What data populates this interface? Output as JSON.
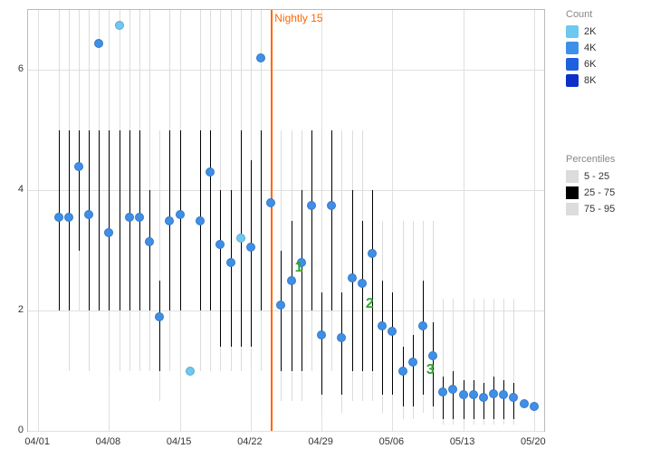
{
  "chart_data": {
    "type": "scatter",
    "title": "",
    "xlabel": "",
    "ylabel": "",
    "ylim": [
      0,
      7
    ],
    "x_ticks": [
      "04/01",
      "04/08",
      "04/15",
      "04/22",
      "04/29",
      "05/06",
      "05/13",
      "05/20"
    ],
    "y_ticks": [
      0,
      2,
      4,
      6
    ],
    "nightly_marker": {
      "label": "Nightly 15",
      "x_index": 24
    },
    "annotations": [
      {
        "label": "1",
        "x_index": 26,
        "y": 2.7
      },
      {
        "label": "2",
        "x_index": 33,
        "y": 2.1
      },
      {
        "label": "3",
        "x_index": 39,
        "y": 1.0
      }
    ],
    "legend_count": {
      "title": "Count",
      "items": [
        {
          "label": "2K",
          "color": "#6ec8f0"
        },
        {
          "label": "4K",
          "color": "#3f8fe8"
        },
        {
          "label": "6K",
          "color": "#1f60e0"
        },
        {
          "label": "8K",
          "color": "#0c30c8"
        }
      ]
    },
    "legend_pct": {
      "title": "Percentiles",
      "items": [
        {
          "label": "5 - 25",
          "color": "#dcdcdc"
        },
        {
          "label": "25 - 75",
          "color": "#000000"
        },
        {
          "label": "75 - 95",
          "color": "#dcdcdc"
        }
      ]
    },
    "points": [
      {
        "x": 3,
        "y": 3.55,
        "c": "#3f8fe8"
      },
      {
        "x": 4,
        "y": 3.55,
        "c": "#3f8fe8"
      },
      {
        "x": 5,
        "y": 4.4,
        "c": "#3f8fe8"
      },
      {
        "x": 6,
        "y": 3.6,
        "c": "#3f8fe8"
      },
      {
        "x": 7,
        "y": 6.45,
        "c": "#3f8fe8"
      },
      {
        "x": 8,
        "y": 3.3,
        "c": "#3f8fe8"
      },
      {
        "x": 9,
        "y": 6.75,
        "c": "#6ec8f0"
      },
      {
        "x": 10,
        "y": 3.55,
        "c": "#3f8fe8"
      },
      {
        "x": 11,
        "y": 3.55,
        "c": "#3f8fe8"
      },
      {
        "x": 12,
        "y": 3.15,
        "c": "#3f8fe8"
      },
      {
        "x": 13,
        "y": 1.9,
        "c": "#3f8fe8"
      },
      {
        "x": 14,
        "y": 3.5,
        "c": "#3f8fe8"
      },
      {
        "x": 15,
        "y": 3.6,
        "c": "#3f8fe8"
      },
      {
        "x": 16,
        "y": 1.0,
        "c": "#6ec8f0"
      },
      {
        "x": 17,
        "y": 3.5,
        "c": "#3f8fe8"
      },
      {
        "x": 18,
        "y": 4.3,
        "c": "#3f8fe8"
      },
      {
        "x": 19,
        "y": 3.1,
        "c": "#3f8fe8"
      },
      {
        "x": 20,
        "y": 2.8,
        "c": "#3f8fe8"
      },
      {
        "x": 21,
        "y": 3.2,
        "c": "#6ec8f0"
      },
      {
        "x": 22,
        "y": 3.05,
        "c": "#3f8fe8"
      },
      {
        "x": 23,
        "y": 6.2,
        "c": "#3f8fe8"
      },
      {
        "x": 24,
        "y": 3.8,
        "c": "#3f8fe8"
      },
      {
        "x": 25,
        "y": 2.1,
        "c": "#3f8fe8"
      },
      {
        "x": 26,
        "y": 2.5,
        "c": "#3f8fe8"
      },
      {
        "x": 27,
        "y": 2.8,
        "c": "#3f8fe8"
      },
      {
        "x": 28,
        "y": 3.75,
        "c": "#3f8fe8"
      },
      {
        "x": 29,
        "y": 1.6,
        "c": "#3f8fe8"
      },
      {
        "x": 30,
        "y": 3.75,
        "c": "#3f8fe8"
      },
      {
        "x": 31,
        "y": 1.55,
        "c": "#3f8fe8"
      },
      {
        "x": 32,
        "y": 2.55,
        "c": "#3f8fe8"
      },
      {
        "x": 33,
        "y": 2.45,
        "c": "#3f8fe8"
      },
      {
        "x": 34,
        "y": 2.95,
        "c": "#3f8fe8"
      },
      {
        "x": 35,
        "y": 1.75,
        "c": "#3f8fe8"
      },
      {
        "x": 36,
        "y": 1.65,
        "c": "#3f8fe8"
      },
      {
        "x": 37,
        "y": 1.0,
        "c": "#3f8fe8"
      },
      {
        "x": 38,
        "y": 1.15,
        "c": "#3f8fe8"
      },
      {
        "x": 39,
        "y": 1.75,
        "c": "#3f8fe8"
      },
      {
        "x": 40,
        "y": 1.25,
        "c": "#3f8fe8"
      },
      {
        "x": 41,
        "y": 0.65,
        "c": "#3f8fe8"
      },
      {
        "x": 42,
        "y": 0.7,
        "c": "#3f8fe8"
      },
      {
        "x": 43,
        "y": 0.6,
        "c": "#3f8fe8"
      },
      {
        "x": 44,
        "y": 0.6,
        "c": "#3f8fe8"
      },
      {
        "x": 45,
        "y": 0.55,
        "c": "#3f8fe8"
      },
      {
        "x": 46,
        "y": 0.62,
        "c": "#3f8fe8"
      },
      {
        "x": 47,
        "y": 0.6,
        "c": "#3f8fe8"
      },
      {
        "x": 48,
        "y": 0.55,
        "c": "#3f8fe8"
      },
      {
        "x": 49,
        "y": 0.45,
        "c": "#3f8fe8"
      },
      {
        "x": 50,
        "y": 0.4,
        "c": "#3f8fe8"
      }
    ],
    "percentile_bars": [
      {
        "x": 3,
        "p5": 2.0,
        "p25": 2.0,
        "p75": 5.0,
        "p95": 7.0
      },
      {
        "x": 4,
        "p5": 1.0,
        "p25": 2.0,
        "p75": 5.0,
        "p95": 7.0
      },
      {
        "x": 5,
        "p5": 2.0,
        "p25": 3.0,
        "p75": 5.0,
        "p95": 7.0
      },
      {
        "x": 6,
        "p5": 1.0,
        "p25": 2.0,
        "p75": 5.0,
        "p95": 7.0
      },
      {
        "x": 7,
        "p5": 2.0,
        "p25": 2.0,
        "p75": 5.0,
        "p95": 7.0
      },
      {
        "x": 8,
        "p5": 1.0,
        "p25": 2.0,
        "p75": 5.0,
        "p95": 7.0
      },
      {
        "x": 9,
        "p5": 1.0,
        "p25": 2.0,
        "p75": 5.0,
        "p95": 7.0
      },
      {
        "x": 10,
        "p5": 1.0,
        "p25": 2.0,
        "p75": 5.0,
        "p95": 7.0
      },
      {
        "x": 11,
        "p5": 1.0,
        "p25": 2.0,
        "p75": 5.0,
        "p95": 7.0
      },
      {
        "x": 12,
        "p5": 1.0,
        "p25": 2.0,
        "p75": 4.0,
        "p95": 7.0
      },
      {
        "x": 13,
        "p5": 0.5,
        "p25": 1.0,
        "p75": 2.5,
        "p95": 5.0
      },
      {
        "x": 14,
        "p5": 1.0,
        "p25": 2.0,
        "p75": 5.0,
        "p95": 7.0
      },
      {
        "x": 15,
        "p5": 1.0,
        "p25": 2.0,
        "p75": 5.0,
        "p95": 7.0
      },
      {
        "x": 17,
        "p5": 1.0,
        "p25": 2.0,
        "p75": 5.0,
        "p95": 7.0
      },
      {
        "x": 18,
        "p5": 1.0,
        "p25": 2.0,
        "p75": 5.0,
        "p95": 7.0
      },
      {
        "x": 19,
        "p5": 1.0,
        "p25": 1.4,
        "p75": 4.0,
        "p95": 7.0
      },
      {
        "x": 20,
        "p5": 1.0,
        "p25": 1.4,
        "p75": 4.0,
        "p95": 7.0
      },
      {
        "x": 21,
        "p5": 1.0,
        "p25": 1.4,
        "p75": 5.0,
        "p95": 7.0
      },
      {
        "x": 22,
        "p5": 1.0,
        "p25": 1.4,
        "p75": 4.5,
        "p95": 7.0
      },
      {
        "x": 23,
        "p5": 1.0,
        "p25": 2.0,
        "p75": 5.0,
        "p95": 7.0
      },
      {
        "x": 24,
        "p5": 1.0,
        "p25": 2.0,
        "p75": 5.0,
        "p95": 7.0
      },
      {
        "x": 25,
        "p5": 0.5,
        "p25": 1.0,
        "p75": 3.0,
        "p95": 5.0
      },
      {
        "x": 26,
        "p5": 0.5,
        "p25": 1.0,
        "p75": 3.5,
        "p95": 5.0
      },
      {
        "x": 27,
        "p5": 0.5,
        "p25": 1.0,
        "p75": 4.0,
        "p95": 5.0
      },
      {
        "x": 28,
        "p5": 1.0,
        "p25": 2.0,
        "p75": 5.0,
        "p95": 5.0
      },
      {
        "x": 29,
        "p5": 0.3,
        "p25": 0.6,
        "p75": 2.3,
        "p95": 5.0
      },
      {
        "x": 30,
        "p5": 1.0,
        "p25": 2.0,
        "p75": 5.0,
        "p95": 5.0
      },
      {
        "x": 31,
        "p5": 0.3,
        "p25": 0.6,
        "p75": 2.3,
        "p95": 5.0
      },
      {
        "x": 32,
        "p5": 0.5,
        "p25": 1.0,
        "p75": 4.0,
        "p95": 5.0
      },
      {
        "x": 33,
        "p5": 0.5,
        "p25": 1.0,
        "p75": 3.5,
        "p95": 5.0
      },
      {
        "x": 34,
        "p5": 0.5,
        "p25": 1.0,
        "p75": 4.0,
        "p95": 3.5
      },
      {
        "x": 35,
        "p5": 0.3,
        "p25": 0.6,
        "p75": 2.5,
        "p95": 3.5
      },
      {
        "x": 36,
        "p5": 0.3,
        "p25": 0.6,
        "p75": 2.3,
        "p95": 3.5
      },
      {
        "x": 37,
        "p5": 0.2,
        "p25": 0.4,
        "p75": 1.4,
        "p95": 3.5
      },
      {
        "x": 38,
        "p5": 0.2,
        "p25": 0.4,
        "p75": 1.6,
        "p95": 3.5
      },
      {
        "x": 39,
        "p5": 0.3,
        "p25": 0.6,
        "p75": 2.5,
        "p95": 3.5
      },
      {
        "x": 40,
        "p5": 0.2,
        "p25": 0.4,
        "p75": 1.8,
        "p95": 3.5
      },
      {
        "x": 41,
        "p5": 0.1,
        "p25": 0.2,
        "p75": 0.9,
        "p95": 2.2
      },
      {
        "x": 42,
        "p5": 0.1,
        "p25": 0.2,
        "p75": 1.0,
        "p95": 2.2
      },
      {
        "x": 43,
        "p5": 0.1,
        "p25": 0.2,
        "p75": 0.85,
        "p95": 2.2
      },
      {
        "x": 44,
        "p5": 0.1,
        "p25": 0.2,
        "p75": 0.85,
        "p95": 2.2
      },
      {
        "x": 45,
        "p5": 0.1,
        "p25": 0.2,
        "p75": 0.8,
        "p95": 2.2
      },
      {
        "x": 46,
        "p5": 0.1,
        "p25": 0.2,
        "p75": 0.9,
        "p95": 2.2
      },
      {
        "x": 47,
        "p5": 0.1,
        "p25": 0.2,
        "p75": 0.85,
        "p95": 2.2
      },
      {
        "x": 48,
        "p5": 0.1,
        "p25": 0.2,
        "p75": 0.8,
        "p95": 2.2
      }
    ]
  }
}
